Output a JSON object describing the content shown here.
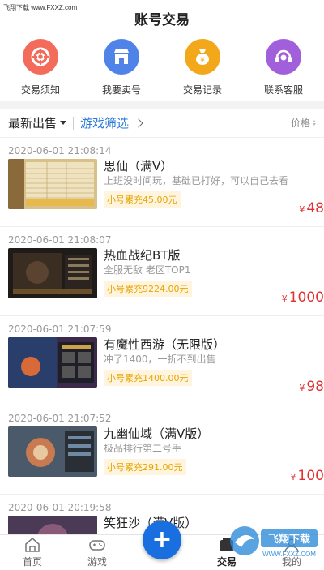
{
  "watermark": {
    "brand": "飞翔下载",
    "url": "www.FXXZ.com"
  },
  "header": {
    "title": "账号交易"
  },
  "quick_actions": [
    {
      "label": "交易须知",
      "icon": "lifebuoy-icon",
      "color": "#f26b5b"
    },
    {
      "label": "我要卖号",
      "icon": "shop-icon",
      "color": "#4f83e8"
    },
    {
      "label": "交易记录",
      "icon": "coin-bag-icon",
      "color": "#f3a81b"
    },
    {
      "label": "联系客服",
      "icon": "headset-icon",
      "color": "#a25fdb"
    }
  ],
  "filter": {
    "latest_label": "最新出售",
    "game_filter_label": "游戏筛选",
    "price_label": "价格"
  },
  "listings": [
    {
      "time": "2020-06-01 21:08:14",
      "name": "思仙（满V）",
      "desc": "上班没时间玩，基础已打好，可以自己去看",
      "tag": "小号累充45.00元",
      "price": "48",
      "currency": "¥"
    },
    {
      "time": "2020-06-01 21:08:07",
      "name": "热血战纪BT版",
      "desc": "全服无敌 老区TOP1",
      "tag": "小号累充9224.00元",
      "price": "1000",
      "currency": "¥"
    },
    {
      "time": "2020-06-01 21:07:59",
      "name": "有魔性西游（无限版）",
      "desc": "冲了1400，一折不到出售",
      "tag": "小号累充1400.00元",
      "price": "98",
      "currency": "¥"
    },
    {
      "time": "2020-06-01 21:07:52",
      "name": "九幽仙域（满V版）",
      "desc": "极品排行第二号手",
      "tag": "小号累充291.00元",
      "price": "100",
      "currency": "¥"
    },
    {
      "time": "2020-06-01 20:19:58",
      "name": "笑狂沙（满V版）",
      "desc": "",
      "tag": "",
      "price": "",
      "currency": ""
    }
  ],
  "tabbar": {
    "tabs": [
      {
        "label": "首页",
        "icon": "home-icon"
      },
      {
        "label": "游戏",
        "icon": "gamepad-icon"
      },
      {
        "label": "",
        "icon": "plus-icon"
      },
      {
        "label": "交易",
        "icon": "trade-icon"
      },
      {
        "label": "我的",
        "icon": "user-icon"
      }
    ],
    "active": "交易"
  },
  "logo_watermark": {
    "text": "飞翔下载",
    "url": "WWW.FXXZ.COM"
  },
  "colors": {
    "accent": "#2a7ad6",
    "price": "#e23030",
    "tag_bg": "#fff4dd",
    "tag_text": "#e8a400",
    "fab": "#1a6fe0"
  }
}
